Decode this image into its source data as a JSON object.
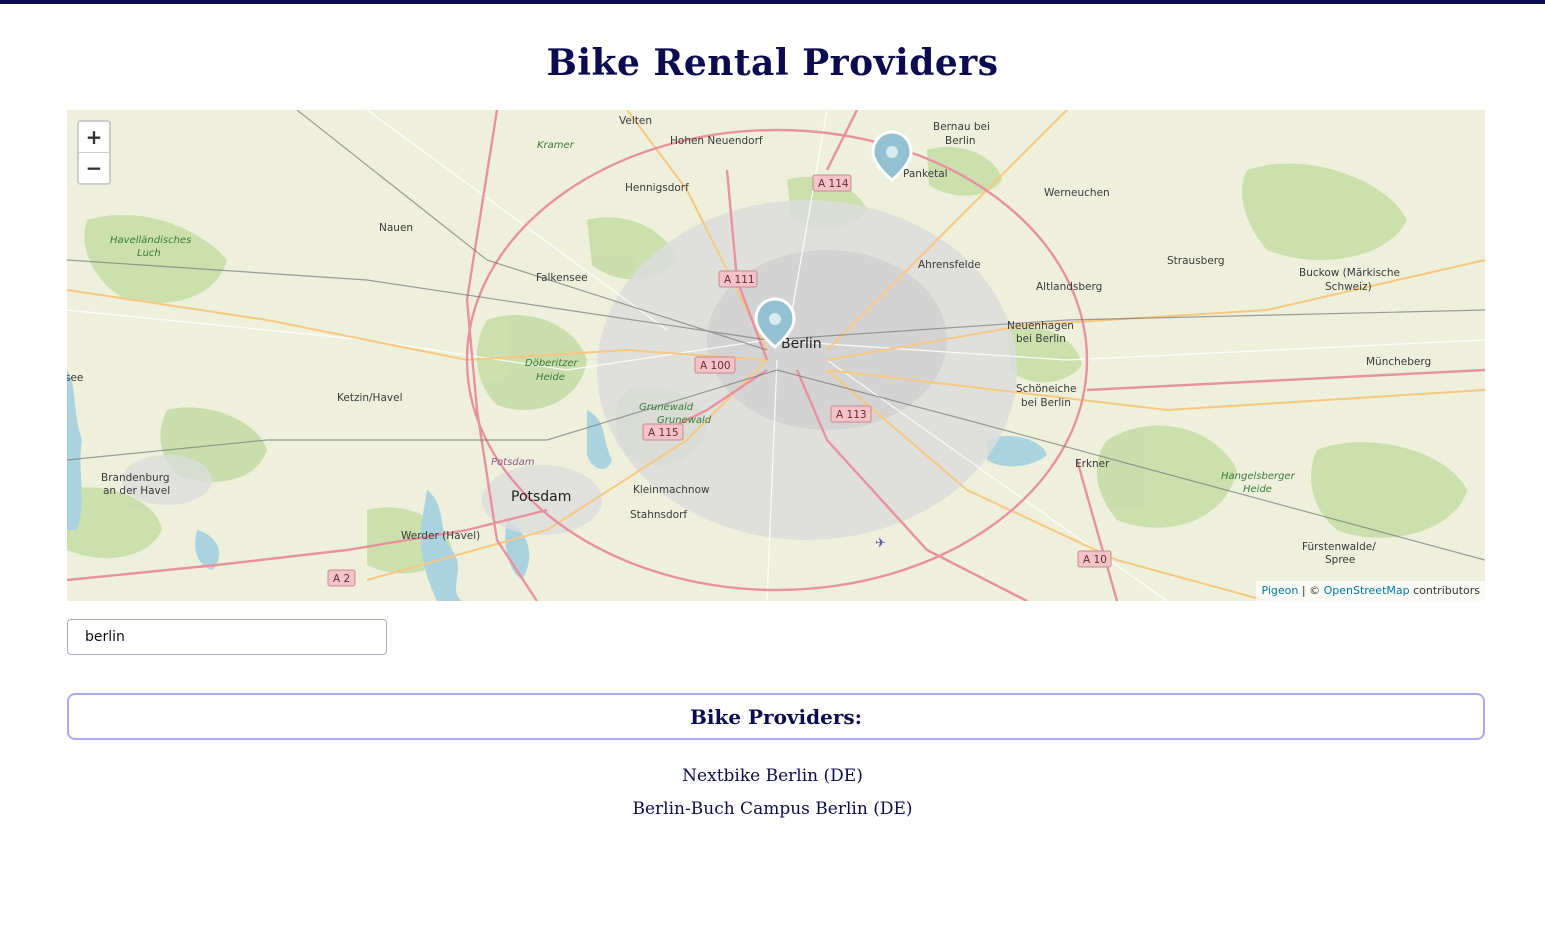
{
  "page": {
    "title": "Bike Rental Providers"
  },
  "map": {
    "zoom_in_label": "+",
    "zoom_out_label": "−",
    "attribution": {
      "library_link": "Pigeon",
      "separator": " | © ",
      "osm_link": "OpenStreetMap",
      "suffix": " contributors"
    },
    "place_labels": [
      "Velten",
      "Hohen Neuendorf",
      "Bernau bei",
      "Berlin",
      "Panketal",
      "Hennigsdorf",
      "Werneuchen",
      "Nauen",
      "Falkensee",
      "Ahrensfelde",
      "Strausberg",
      "Altlandsberg",
      "Buckow (Märkische",
      "Schweiz)",
      "Neuenhagen",
      "bei Berlin",
      "Müncheberg",
      "Schöneiche",
      "bei Berlin",
      "Ketzin/Havel",
      "Erkner",
      "Brandenburg",
      "an der Havel",
      "Potsdam",
      "Kleinmachnow",
      "Stahnsdorf",
      "Werder (Havel)",
      "Fürstenwalde/",
      "Spree",
      "see",
      "Berlin",
      "Kramer",
      "Havelländisches",
      "Luch",
      "Döberitzer",
      "Heide",
      "Grunewald",
      "Grunewald",
      "Potsdam",
      "Hangelsberger",
      "Heide"
    ],
    "road_shields": [
      "A 114",
      "A 111",
      "A 100",
      "A 113",
      "A 115",
      "A 10",
      "A 2"
    ],
    "markers": [
      {
        "name": "Nextbike Berlin (DE)"
      },
      {
        "name": "Berlin-Buch Campus Berlin (DE)"
      }
    ],
    "colors": {
      "marker": "#93c1d2",
      "motorway": "#e8929f",
      "primary_road": "#f7c882",
      "forest": "#c8deaa",
      "water": "#aad3df",
      "urban": "#dcdcdc"
    }
  },
  "search": {
    "value": "berlin",
    "placeholder": ""
  },
  "providers": {
    "heading": "Bike Providers:",
    "items": [
      "Nextbike Berlin (DE)",
      "Berlin-Buch Campus Berlin (DE)"
    ]
  }
}
